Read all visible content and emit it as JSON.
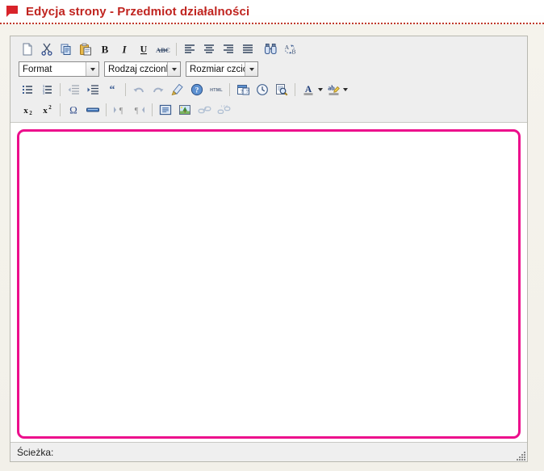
{
  "header": {
    "icon": "red-flag-icon",
    "title": "Edycja strony - Przedmiot działalności"
  },
  "editor": {
    "toolbar": {
      "row1": [
        {
          "name": "new-page-button",
          "icon": "new-page-icon",
          "tooltip": "Nowa strona",
          "disabled": false
        },
        {
          "name": "cut-button",
          "icon": "scissors-icon",
          "tooltip": "Wytnij",
          "disabled": false
        },
        {
          "name": "copy-button",
          "icon": "copy-icon",
          "tooltip": "Kopiuj",
          "disabled": false
        },
        {
          "name": "paste-button",
          "icon": "paste-icon",
          "tooltip": "Wklej",
          "disabled": false
        },
        {
          "name": "bold-button",
          "icon": "bold-icon",
          "tooltip": "Pogrubienie",
          "disabled": false
        },
        {
          "name": "italic-button",
          "icon": "italic-icon",
          "tooltip": "Kursywa",
          "disabled": false
        },
        {
          "name": "underline-button",
          "icon": "underline-icon",
          "tooltip": "Podkreślenie",
          "disabled": false
        },
        {
          "name": "strikethrough-button",
          "icon": "strikethrough-icon",
          "tooltip": "Przekreślenie",
          "disabled": false
        },
        {
          "name": "align-left-button",
          "icon": "align-left-icon",
          "tooltip": "Do lewej",
          "disabled": false
        },
        {
          "name": "align-center-button",
          "icon": "align-center-icon",
          "tooltip": "Wyśrodkuj",
          "disabled": false
        },
        {
          "name": "align-right-button",
          "icon": "align-right-icon",
          "tooltip": "Do prawej",
          "disabled": false
        },
        {
          "name": "align-justify-button",
          "icon": "align-justify-icon",
          "tooltip": "Wyjustuj",
          "disabled": false
        },
        {
          "name": "find-button",
          "icon": "binoculars-icon",
          "tooltip": "Znajdź",
          "disabled": false
        },
        {
          "name": "replace-button",
          "icon": "replace-ab-icon",
          "tooltip": "Zamień",
          "disabled": false
        }
      ],
      "row2": [
        {
          "name": "format-select",
          "label": "Format",
          "options": [
            "Format"
          ]
        },
        {
          "name": "fontname-select",
          "label": "Rodzaj czcionk",
          "options": [
            "Rodzaj czcionki"
          ]
        },
        {
          "name": "fontsize-select",
          "label": "Rozmiar czcion",
          "options": [
            "Rozmiar czcionki"
          ]
        }
      ],
      "row3": [
        {
          "name": "bulleted-list-button",
          "icon": "bulleted-list-icon",
          "tooltip": "Lista wypunktowana",
          "disabled": false
        },
        {
          "name": "numbered-list-button",
          "icon": "numbered-list-icon",
          "tooltip": "Lista numerowana",
          "disabled": false
        },
        {
          "name": "outdent-button",
          "icon": "outdent-icon",
          "tooltip": "Zmniejsz wcięcie",
          "disabled": true
        },
        {
          "name": "indent-button",
          "icon": "indent-icon",
          "tooltip": "Zwiększ wcięcie",
          "disabled": false
        },
        {
          "name": "blockquote-button",
          "icon": "blockquote-icon",
          "tooltip": "Cytat",
          "disabled": false
        },
        {
          "name": "undo-button",
          "icon": "undo-icon",
          "tooltip": "Cofnij",
          "disabled": true
        },
        {
          "name": "redo-button",
          "icon": "redo-icon",
          "tooltip": "Ponów",
          "disabled": true
        },
        {
          "name": "remove-format-button",
          "icon": "eraser-brush-icon",
          "tooltip": "Usuń formatowanie",
          "disabled": false
        },
        {
          "name": "about-button",
          "icon": "info-circle-icon",
          "tooltip": "Informacje",
          "disabled": false
        },
        {
          "name": "source-button",
          "icon": "html-source-icon",
          "tooltip": "HTML",
          "disabled": false
        },
        {
          "name": "insert-date-button",
          "icon": "calendar-icon",
          "tooltip": "Wstaw datę",
          "disabled": false
        },
        {
          "name": "insert-time-button",
          "icon": "clock-icon",
          "tooltip": "Wstaw czas",
          "disabled": false
        },
        {
          "name": "preview-button",
          "icon": "preview-magnifier-icon",
          "tooltip": "Podgląd",
          "disabled": false
        },
        {
          "name": "text-color-button",
          "icon": "text-color-a-icon",
          "tooltip": "Kolor tekstu",
          "disabled": false,
          "arrow": true
        },
        {
          "name": "bg-color-button",
          "icon": "highlight-ab-icon",
          "tooltip": "Kolor tła",
          "disabled": false,
          "arrow": true
        }
      ],
      "row4": [
        {
          "name": "subscript-button",
          "icon": "subscript-icon",
          "tooltip": "Indeks dolny",
          "disabled": false
        },
        {
          "name": "superscript-button",
          "icon": "superscript-icon",
          "tooltip": "Indeks górny",
          "disabled": false
        },
        {
          "name": "special-char-button",
          "icon": "omega-icon",
          "tooltip": "Znak specjalny",
          "disabled": false
        },
        {
          "name": "horizontal-rule-button",
          "icon": "horizontal-rule-icon",
          "tooltip": "Linia pozioma",
          "disabled": false
        },
        {
          "name": "ltr-button",
          "icon": "text-ltr-icon",
          "tooltip": "Kierunek od lewej",
          "disabled": true
        },
        {
          "name": "rtl-button",
          "icon": "text-rtl-icon",
          "tooltip": "Kierunek od prawej",
          "disabled": true
        },
        {
          "name": "flash-button",
          "icon": "flash-page-icon",
          "tooltip": "Wstaw obiekt",
          "disabled": false
        },
        {
          "name": "image-button",
          "icon": "image-tree-icon",
          "tooltip": "Obrazek",
          "disabled": false
        },
        {
          "name": "link-button",
          "icon": "chain-link-icon",
          "tooltip": "Wstaw odnośnik",
          "disabled": true
        },
        {
          "name": "unlink-button",
          "icon": "broken-chain-icon",
          "tooltip": "Usuń odnośnik",
          "disabled": true
        }
      ]
    },
    "content": {
      "value": "",
      "placeholder": ""
    },
    "statusbar": {
      "path_label": "Ścieżka:",
      "path_value": "",
      "resize_grip": "resize-grip-icon"
    }
  },
  "colors": {
    "title_red": "#c0241f",
    "accent_magenta": "#ec0e8c",
    "page_bg": "#f3f1ea",
    "toolbar_bg": "#eeeeee"
  }
}
